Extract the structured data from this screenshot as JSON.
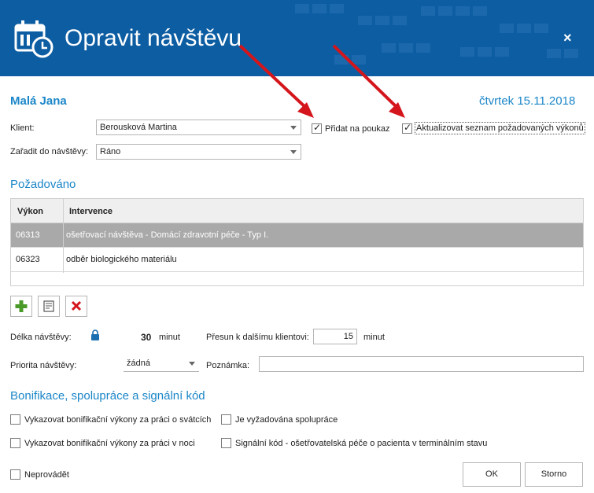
{
  "window": {
    "title": "Opravit návštěvu",
    "close_label": "×"
  },
  "patient_name": "Malá Jana",
  "visit_date": "čtvrtek 15.11.2018",
  "client": {
    "label": "Klient:",
    "value": "Berousková Martina"
  },
  "add_to_voucher": {
    "label": "Přidat na poukaz",
    "checked": true
  },
  "update_list": {
    "label": "Aktualizovat seznam požadovaných výkonů",
    "checked": true
  },
  "assign": {
    "label": "Zařadit do návštěvy:",
    "value": "Ráno"
  },
  "requested": {
    "title": "Požadováno",
    "columns": [
      "Výkon",
      "Intervence"
    ],
    "rows": [
      {
        "code": "06313",
        "intervention": "ošetřovací návštěva - Domácí zdravotní péče - Typ I.",
        "selected": true
      },
      {
        "code": "06323",
        "intervention": "odběr biologického materiálu",
        "selected": false
      }
    ]
  },
  "toolbar": {
    "add_icon": "plus-icon",
    "edit_icon": "edit-icon",
    "delete_icon": "delete-icon"
  },
  "duration": {
    "label": "Délka návštěvy:",
    "value": "30",
    "unit": "minut",
    "icon": "lock-icon"
  },
  "transfer": {
    "label": "Přesun k dalšímu klientovi:",
    "value": "15",
    "unit": "minut"
  },
  "priority": {
    "label": "Priorita návštěvy:",
    "value": "žádná"
  },
  "note": {
    "label": "Poznámka:",
    "value": ""
  },
  "bonus": {
    "title": "Bonifikace, spolupráce a signální kód",
    "holiday": {
      "label": "Vykazovat bonifikační výkony za práci o svátcích",
      "checked": false
    },
    "cooperation": {
      "label": "Je vyžadována spolupráce",
      "checked": false
    },
    "night": {
      "label": "Vykazovat bonifikační výkony za práci v noci",
      "checked": false
    },
    "signal": {
      "label": "Signální kód - ošetřovatelská péče o pacienta v terminálním stavu",
      "checked": false
    }
  },
  "not_performed": {
    "label": "Neprovádět",
    "checked": false
  },
  "buttons": {
    "ok": "OK",
    "cancel": "Storno"
  },
  "colors": {
    "header_bg": "#0d5da3",
    "accent": "#1b86c8",
    "selected_row": "#a9a9a9",
    "arrow": "#d4161c"
  }
}
